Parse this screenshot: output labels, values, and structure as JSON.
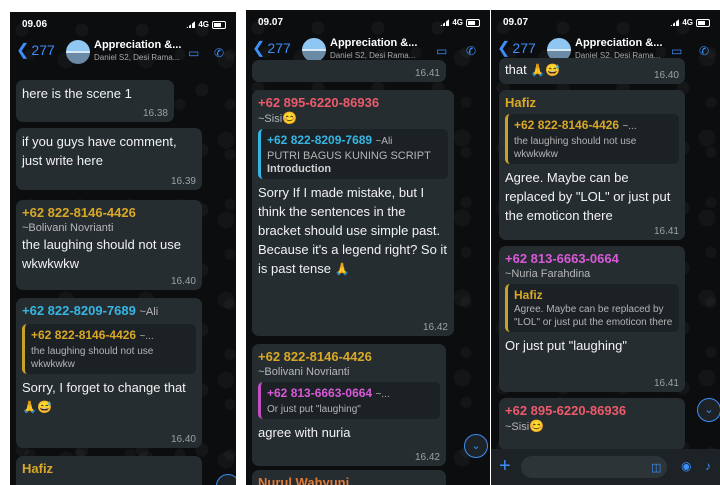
{
  "chat_title": "Appreciation &...",
  "chat_members": "Daniel S2, Desi Rama...",
  "back_count": "277",
  "panels": [
    {
      "status_time": "09.06",
      "network": "4G",
      "messages": [
        {
          "text": "here is the scene 1",
          "time": "16.38"
        },
        {
          "text": "if you guys have comment, just write here",
          "time": "16.39"
        },
        {
          "sender": "+62 822-8146-4426",
          "alias": "~Bolivani Novrianti",
          "text": "the laughing should not use wkwkwkw",
          "time": "16.40"
        },
        {
          "sender": "+62 822-8209-7689",
          "alias": "~Ali",
          "quote_sender": "+62 822-8146-4426",
          "quote_alias": "~...",
          "quote_text": "the laughing should not use wkwkwkw",
          "text": "Sorry, I forget to change that",
          "time": "16.40"
        },
        {
          "sender": "Hafiz"
        }
      ]
    },
    {
      "status_time": "09.07",
      "network": "4G",
      "messages": [
        {
          "time": "16.41"
        },
        {
          "sender": "+62 895-6220-86936",
          "alias": "~Sisi",
          "quote_sender": "+62 822-8209-7689",
          "quote_alias": "~Ali",
          "quote_text": "PUTRI BAGUS KUNING SCRIPT",
          "quote_text2": "Introduction",
          "text": "Sorry If I made mistake, but I think the sentences in the bracket should use simple past. Because it's a legend right? So it is past tense",
          "time": "16.42"
        },
        {
          "sender": "+62 822-8146-4426",
          "alias": "~Bolivani Novrianti",
          "quote_sender": "+62 813-6663-0664",
          "quote_alias": "~...",
          "quote_text": "Or just put \"laughing\"",
          "text": "agree with nuria",
          "time": "16.42"
        },
        {
          "sender": "Nurul Wahyuni"
        }
      ]
    },
    {
      "status_time": "09.07",
      "network": "4G",
      "messages": [
        {
          "text": "that",
          "time": "16.40"
        },
        {
          "sender": "Hafiz",
          "quote_sender": "+62 822-8146-4426",
          "quote_alias": "~...",
          "quote_text": "the laughing should not use wkwkwkw",
          "text": "Agree. Maybe can be replaced by \"LOL\" or just put the emoticon there",
          "time": "16.41"
        },
        {
          "sender": "+62 813-6663-0664",
          "alias": "~Nuria Farahdina",
          "quote_sender": "Hafiz",
          "quote_text": "Agree. Maybe can be replaced by \"LOL\" or just put the emoticon there",
          "text": "Or just put \"laughing\"",
          "time": "16.41"
        },
        {
          "sender": "+62 895-6220-86936",
          "alias": "~Sisi"
        }
      ]
    }
  ],
  "colors": {
    "background": "#0b0d0f",
    "bubble": "#262d31",
    "accent": "#3d8ef7"
  }
}
